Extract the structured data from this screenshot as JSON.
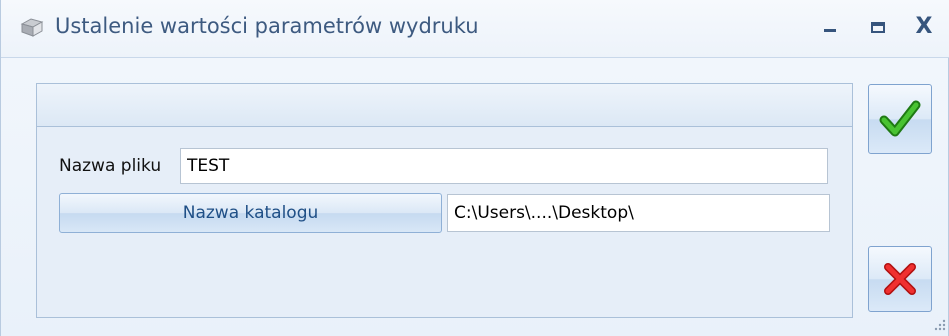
{
  "window": {
    "title": "Ustalenie wartości parametrów wydruku",
    "icon": "app-icon",
    "controls": {
      "minimize": "–",
      "maximize": "□",
      "close": "X"
    }
  },
  "form": {
    "file_label": "Nazwa pliku",
    "file_value": "TEST",
    "dir_button_label": "Nazwa katalogu",
    "dir_value": "C:\\Users\\....\\Desktop\\"
  },
  "actions": {
    "ok_icon": "checkmark-icon",
    "cancel_icon": "cross-icon"
  },
  "colors": {
    "title_text": "#3d5a80",
    "button_text": "#1f4f86",
    "ok_green": "#2f9a1e",
    "cancel_red": "#e02020"
  }
}
